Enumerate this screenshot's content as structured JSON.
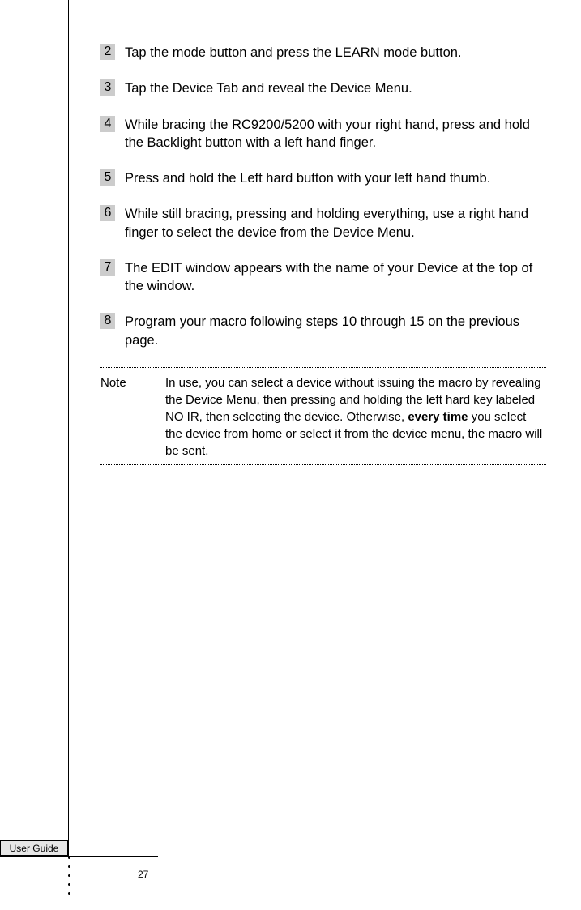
{
  "steps": [
    {
      "num": "2",
      "text": "Tap the mode button and press the LEARN mode button."
    },
    {
      "num": "3",
      "text": "Tap the Device Tab and reveal the Device Menu."
    },
    {
      "num": "4",
      "text": "While bracing the RC9200/5200 with your right hand, press and hold the Backlight button with a left hand finger."
    },
    {
      "num": "5",
      "text": "Press and hold the Left hard button with your left hand thumb."
    },
    {
      "num": "6",
      "text": "While still bracing, pressing and holding everything, use a right hand finger to select the device from the Device Menu."
    },
    {
      "num": "7",
      "text": "The EDIT window appears with the name of your Device at the top of the window."
    },
    {
      "num": "8",
      "text": "Program your macro following steps 10 through 15 on the previous page."
    }
  ],
  "note": {
    "label": "Note",
    "text_before": "In use, you can select a device without issuing the macro by revealing the Device Menu, then pressing and holding the left hard key labeled NO IR, then selecting the device. Otherwise, ",
    "bold": "every time",
    "text_after": " you select the device from home or select it from the device menu, the macro will be sent."
  },
  "footer": {
    "tab": "User Guide",
    "page": "27"
  }
}
